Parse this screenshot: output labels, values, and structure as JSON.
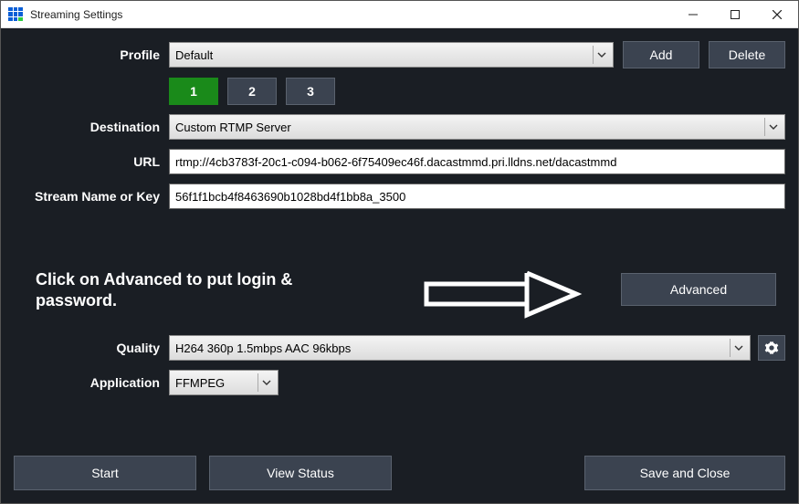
{
  "titlebar": {
    "title": "Streaming Settings"
  },
  "profile": {
    "label": "Profile",
    "value": "Default",
    "add_label": "Add",
    "delete_label": "Delete"
  },
  "tabs": {
    "t1": "1",
    "t2": "2",
    "t3": "3"
  },
  "destination": {
    "label": "Destination",
    "value": "Custom RTMP Server"
  },
  "url": {
    "label": "URL",
    "value": "rtmp://4cb3783f-20c1-c094-b062-6f75409ec46f.dacastmmd.pri.lldns.net/dacastmmd"
  },
  "stream_key": {
    "label": "Stream Name or Key",
    "value": "56f1f1bcb4f8463690b1028bd4f1bb8a_3500"
  },
  "instruction_text": "Click on Advanced to put login & password.",
  "advanced_label": "Advanced",
  "quality": {
    "label": "Quality",
    "value": "H264 360p 1.5mbps AAC 96kbps"
  },
  "application": {
    "label": "Application",
    "value": "FFMPEG"
  },
  "bottom": {
    "start": "Start",
    "view_status": "View Status",
    "save_close": "Save and Close"
  }
}
